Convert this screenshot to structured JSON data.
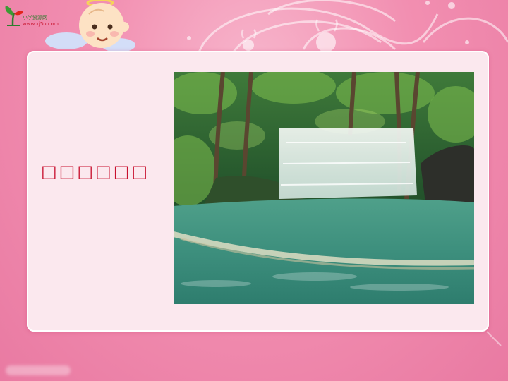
{
  "logo": {
    "name_cn": "小学资源网",
    "url": "www.xj5u.com"
  },
  "slide": {
    "caption": "□□□□□□"
  },
  "photo": {
    "subject": "waterfall-in-forest-icon"
  },
  "colors": {
    "background": "#f28fb1",
    "panel": "#fbe8ee",
    "caption": "#c8102e",
    "logo_green": "#2f7d2f",
    "logo_red": "#c9152f"
  }
}
